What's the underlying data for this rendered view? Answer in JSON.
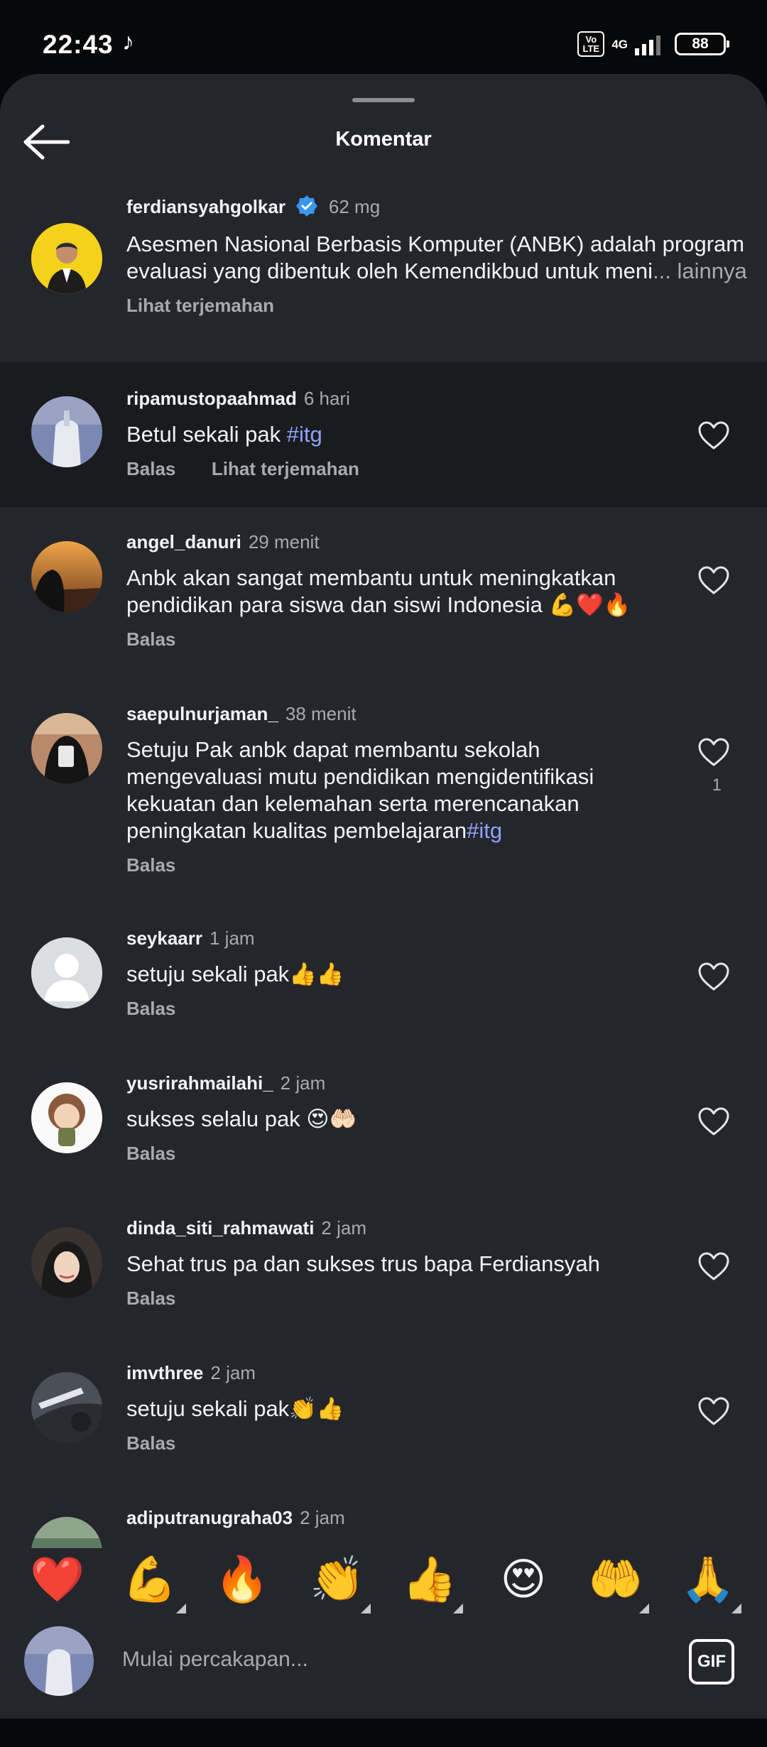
{
  "status_bar": {
    "time": "22:43",
    "volte": "Vo LTE",
    "network": "4G",
    "battery": "88"
  },
  "header": {
    "title": "Komentar"
  },
  "post": {
    "username": "ferdiansyahgolkar",
    "time": "62 mg",
    "text": "Asesmen Nasional Berbasis Komputer (ANBK) adalah program evaluasi yang dibentuk oleh Kemendikbud untuk meni",
    "more": "... lainnya",
    "translate": "Lihat terjemahan"
  },
  "comments": [
    {
      "username": "ripamustopaahmad",
      "time": "6 hari",
      "text": "Betul sekali pak ",
      "hashtag": "#itg",
      "reply": "Balas",
      "translate": "Lihat terjemahan"
    },
    {
      "username": "angel_danuri",
      "time": "29 menit",
      "text": "Anbk akan sangat membantu untuk meningkatkan pendidikan para siswa dan siswi Indonesia 💪❤️🔥",
      "reply": "Balas"
    },
    {
      "username": "saepulnurjaman_",
      "time": "38 menit",
      "text": "Setuju Pak anbk dapat membantu sekolah mengevaluasi mutu pendidikan mengidentifikasi kekuatan dan kelemahan serta merencanakan peningkatan kualitas pembelajaran",
      "hashtag": "#itg",
      "reply": "Balas",
      "likes": "1"
    },
    {
      "username": "seykaarr",
      "time": "1 jam",
      "text": "setuju sekali pak👍👍",
      "reply": "Balas"
    },
    {
      "username": "yusrirahmailahi_",
      "time": "2 jam",
      "text": "sukses selalu pak 😍🤲🏻",
      "reply": "Balas"
    },
    {
      "username": "dinda_siti_rahmawati",
      "time": "2 jam",
      "text": "Sehat trus pa dan sukses trus bapa Ferdiansyah",
      "reply": "Balas"
    },
    {
      "username": "imvthree",
      "time": "2 jam",
      "text": "setuju sekali pak👏👍",
      "reply": "Balas"
    },
    {
      "username": "adiputranugraha03",
      "time": "2 jam"
    }
  ],
  "quick_emojis": [
    "❤️",
    "💪",
    "🔥",
    "👏",
    "👍",
    "😍",
    "🤲",
    "🙏"
  ],
  "input": {
    "placeholder": "Mulai percakapan...",
    "gif_label": "GIF"
  }
}
